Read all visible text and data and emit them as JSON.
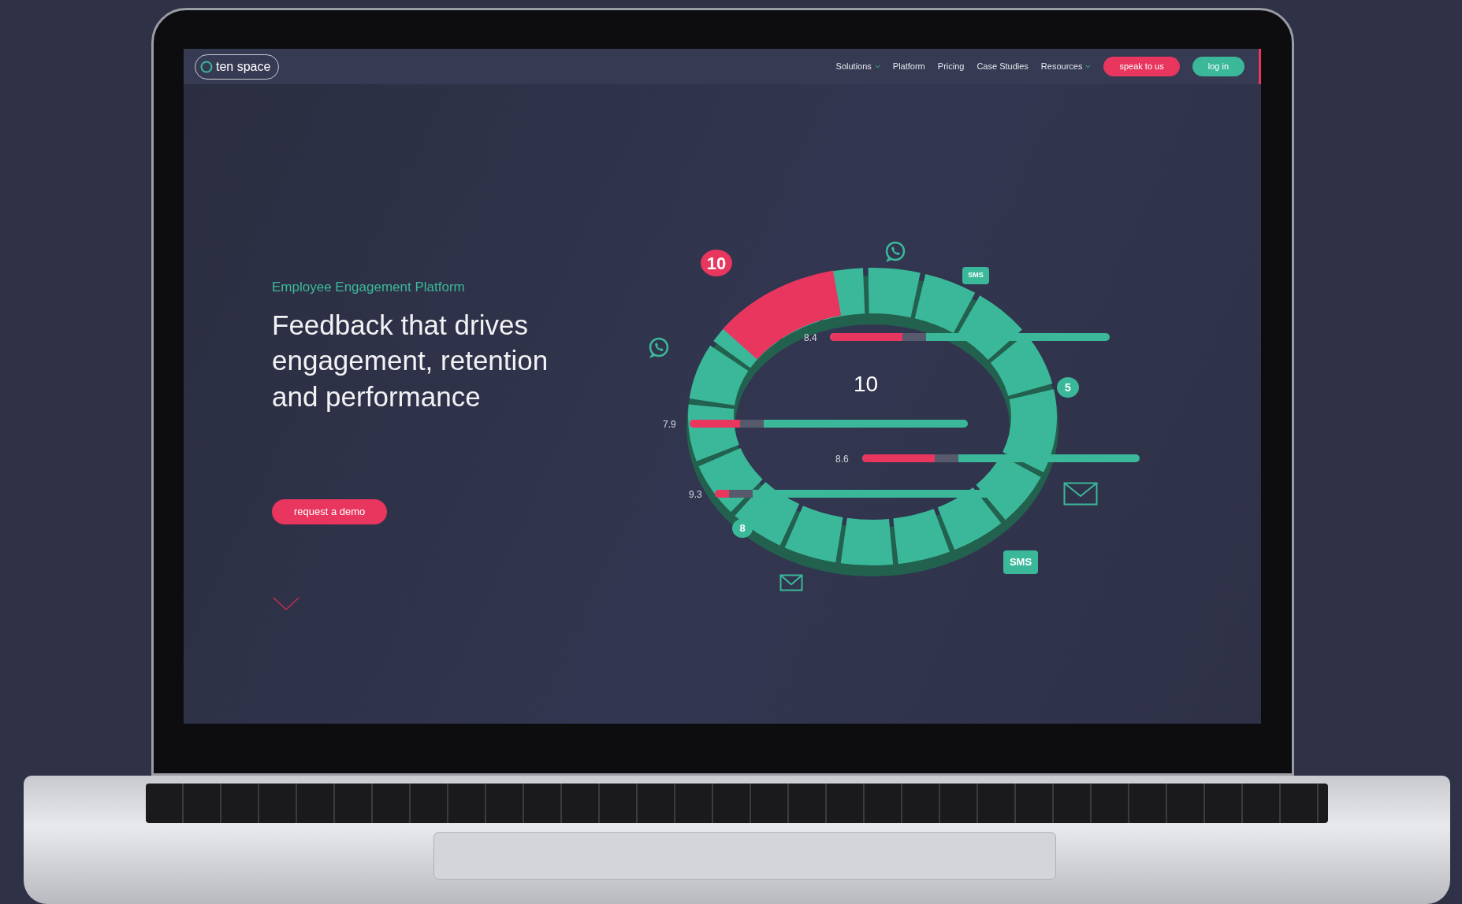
{
  "site": {
    "logo_text": "ten space"
  },
  "nav": {
    "items": [
      {
        "label": "Solutions",
        "dropdown": true
      },
      {
        "label": "Platform",
        "dropdown": false
      },
      {
        "label": "Pricing",
        "dropdown": false
      },
      {
        "label": "Case Studies",
        "dropdown": false
      },
      {
        "label": "Resources",
        "dropdown": true
      }
    ],
    "buttons": [
      {
        "label": "speak to us",
        "kind": "primary"
      },
      {
        "label": "log in",
        "kind": "secondary"
      }
    ]
  },
  "hero": {
    "eyebrow": "Employee Engagement Platform",
    "title": "Feedback that drives engagement, retention and performance",
    "cta": "request a demo"
  },
  "visual": {
    "center_score": "10",
    "bars": [
      {
        "reading": "8.4",
        "level": 0.26
      },
      {
        "reading": "7.9",
        "level": 0.18
      },
      {
        "reading": "8.6",
        "level": 0.26
      },
      {
        "reading": "9.3",
        "level": 0.05
      }
    ],
    "bubbles": [
      {
        "text": "10",
        "color": "#e8365f"
      },
      {
        "text": "5",
        "color": "#3bb89a"
      },
      {
        "text": "8",
        "color": "#3bb89a"
      },
      {
        "text": "SMS",
        "color": "#3bb89a"
      },
      {
        "text": "SMS",
        "color": "#3bb89a"
      }
    ]
  }
}
